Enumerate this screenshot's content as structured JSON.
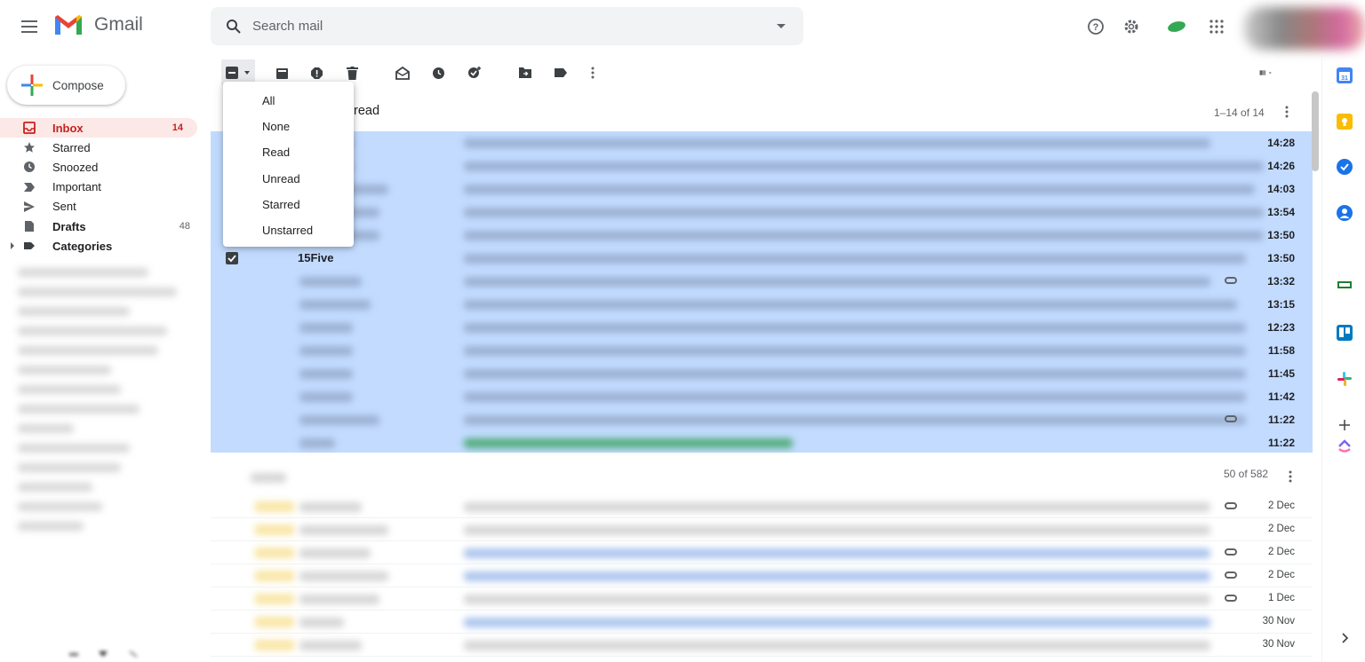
{
  "header": {
    "app_name": "Gmail",
    "search_placeholder": "Search mail"
  },
  "compose_label": "Compose",
  "sidebar": {
    "items": [
      {
        "label": "Inbox",
        "count": "14",
        "icon": "inbox-icon"
      },
      {
        "label": "Starred",
        "count": "",
        "icon": "star-icon"
      },
      {
        "label": "Snoozed",
        "count": "",
        "icon": "clock-icon"
      },
      {
        "label": "Important",
        "count": "",
        "icon": "important-icon"
      },
      {
        "label": "Sent",
        "count": "",
        "icon": "send-icon"
      },
      {
        "label": "Drafts",
        "count": "48",
        "icon": "draft-icon"
      },
      {
        "label": "Categories",
        "count": "",
        "icon": "label-icon"
      }
    ]
  },
  "list": {
    "section_title": "read",
    "range": "1–14 of 14",
    "section2_range": "50 of 582",
    "visible_sender": "15Five",
    "times": [
      "14:28",
      "14:26",
      "14:03",
      "13:54",
      "13:50",
      "13:50",
      "13:32",
      "13:15",
      "12:23",
      "11:58",
      "11:45",
      "11:42",
      "11:22",
      "11:22"
    ],
    "dates": [
      "2 Dec",
      "2 Dec",
      "2 Dec",
      "2 Dec",
      "1 Dec",
      "30 Nov",
      "30 Nov"
    ]
  },
  "select_menu": {
    "options": [
      "All",
      "None",
      "Read",
      "Unread",
      "Starred",
      "Unstarred"
    ]
  },
  "colors": {
    "selected_bg": "#c2dbff",
    "inbox_active_bg": "#fce8e6",
    "inbox_active_text": "#c5221f"
  }
}
